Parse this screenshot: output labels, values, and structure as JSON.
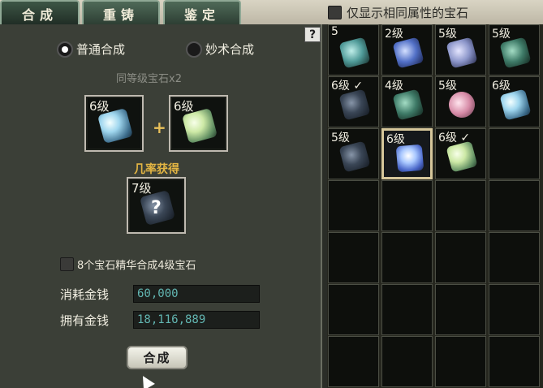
{
  "tabs": [
    "合成",
    "重铸",
    "鉴定"
  ],
  "filter_label": "仅显示相同属性的宝石",
  "help_label": "?",
  "modes": {
    "normal": "普通合成",
    "advanced": "妙术合成"
  },
  "same_level_hint": "同等级宝石x2",
  "inputs": [
    {
      "level": "6级",
      "icon": "ice-gem-icon"
    },
    {
      "level": "6级",
      "icon": "jade-gem-icon"
    }
  ],
  "plus": "+",
  "chance_label": "几率获得",
  "result": {
    "level": "7级",
    "mark": "?"
  },
  "essence_label": "8个宝石精华合成4级宝石",
  "cost_label": "消耗金钱",
  "cost_value": "60,000",
  "owned_label": "拥有金钱",
  "owned_value": "18,116,889",
  "craft_button": "合成",
  "inventory": [
    {
      "label": "5",
      "gem": "crystal"
    },
    {
      "label": "2级",
      "gem": "blue"
    },
    {
      "label": "5级",
      "gem": "lav"
    },
    {
      "label": "5级",
      "gem": "green"
    },
    {
      "label": "6级 ✓",
      "gem": "dark"
    },
    {
      "label": "4级",
      "gem": "green"
    },
    {
      "label": "5级",
      "gem": "pink"
    },
    {
      "label": "6级",
      "gem": "ice"
    },
    {
      "label": "5级",
      "gem": "dark"
    },
    {
      "label": "6级",
      "gem": "glow",
      "selected": true
    },
    {
      "label": "6级 ✓",
      "gem": "jade"
    },
    {
      "label": "",
      "gem": ""
    }
  ],
  "colors": {
    "accent": "#e3b543",
    "money": "#62b6b2",
    "panel": "#3b3f37"
  }
}
